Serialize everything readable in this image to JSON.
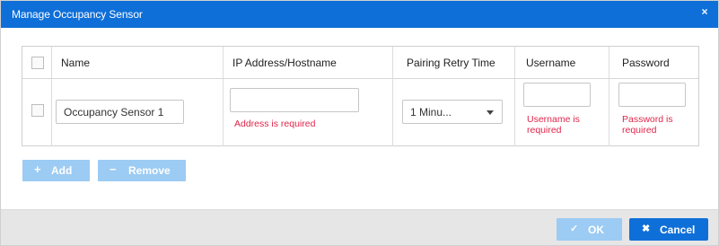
{
  "dialog": {
    "title": "Manage Occupancy Sensor",
    "close_glyph": "×"
  },
  "table": {
    "headers": {
      "name": "Name",
      "ip": "IP Address/Hostname",
      "retry": "Pairing Retry Time",
      "username": "Username",
      "password": "Password"
    },
    "rows": [
      {
        "selected": false,
        "name": "Occupancy Sensor 1",
        "ip": "",
        "ip_error": "Address is required",
        "retry": "1 Minu...",
        "username": "",
        "username_error": "Username is required",
        "password": "",
        "password_error": "Password is required"
      }
    ]
  },
  "toolbar": {
    "add_label": "Add",
    "remove_label": "Remove",
    "add_glyph": "+",
    "remove_glyph": "−"
  },
  "footer": {
    "ok_label": "OK",
    "cancel_label": "Cancel",
    "ok_glyph": "✓",
    "cancel_glyph": "✖"
  },
  "colors": {
    "accent": "#0f6fd8",
    "disabled_button": "#9ccbf3",
    "error_text": "#e0254b",
    "footer_background": "#e6e6e6"
  },
  "icons": [
    "close-icon",
    "plus-icon",
    "minus-icon",
    "caret-down-icon",
    "check-icon",
    "x-icon"
  ]
}
